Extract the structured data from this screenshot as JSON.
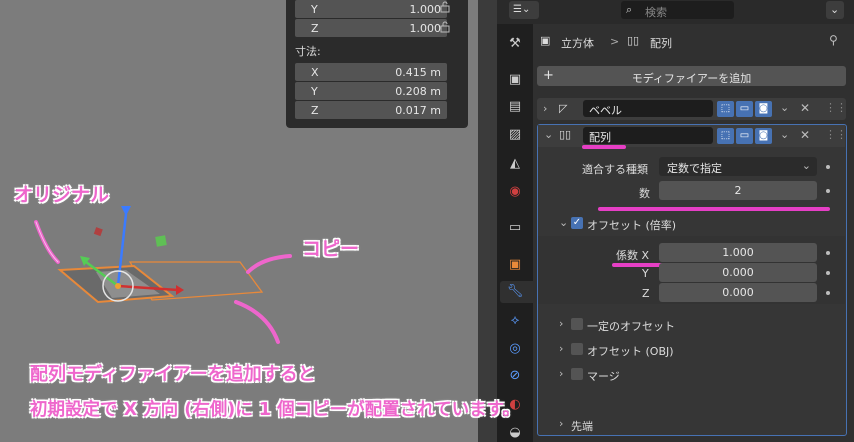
{
  "npanel": {
    "rows": [
      {
        "axis": "Y",
        "value": "1.000"
      },
      {
        "axis": "Z",
        "value": "1.000"
      }
    ],
    "dims_label": "寸法:",
    "dims": [
      {
        "axis": "X",
        "value": "0.415 m"
      },
      {
        "axis": "Y",
        "value": "0.208 m"
      },
      {
        "axis": "Z",
        "value": "0.017 m"
      }
    ]
  },
  "header": {
    "search_placeholder": "検索"
  },
  "breadcrumb": {
    "object": "立方体",
    "separator": ">",
    "modifier": "配列"
  },
  "add_modifier_label": "モディファイアーを追加",
  "bevel": {
    "name": "ベベル"
  },
  "array": {
    "name": "配列",
    "fit_type_label": "適合する種類",
    "fit_type_value": "定数で指定",
    "count_label": "数",
    "count_value": "2",
    "offset_label": "オフセット (倍率)",
    "factor_x_label": "係数 X",
    "factor_x": "1.000",
    "factor_y_label": "Y",
    "factor_y": "0.000",
    "factor_z_label": "Z",
    "factor_z": "0.000",
    "constant_offset": "一定のオフセット",
    "object_offset": "オフセット (OBJ)",
    "merge": "マージ",
    "caps": "先端"
  },
  "annotations": {
    "original": "オリジナル",
    "copy": "コピー",
    "caption_line1": "配列モディファイアーを追加すると",
    "caption_line2": "初期設定で X 方向 (右側)に 1 個コピーが配置されています。"
  },
  "colors": {
    "annotation": "#ee66cc",
    "underline": "#e63fc5",
    "accent_blue": "#4772b3",
    "selection_orange": "#e8893a"
  },
  "icons": [
    "editor-type-icon",
    "search-icon",
    "object-cube-icon",
    "array-modifier-icon",
    "pin-icon",
    "bevel-modifier-icon",
    "editmode-icon",
    "realtime-icon",
    "render-icon",
    "close-icon",
    "checkbox-icon",
    "wrench-icon",
    "lock-icon"
  ]
}
